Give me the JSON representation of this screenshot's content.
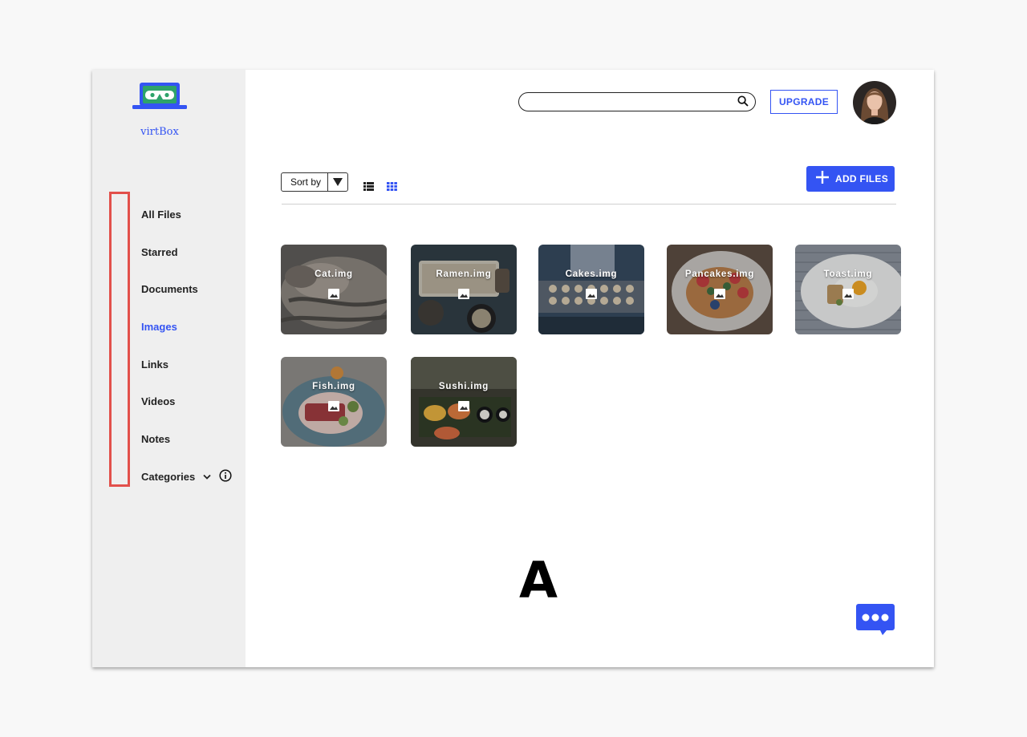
{
  "app": {
    "logo_text": "virtBox",
    "brand_color": "#3454f3",
    "logo_color": "#2ea36a"
  },
  "header": {
    "search": {
      "value": "",
      "placeholder": "",
      "icon": "search-icon"
    },
    "upgrade_label": "UPGRADE",
    "avatar": "user-avatar"
  },
  "sidebar": {
    "highlight_color": "#e2504b",
    "items": [
      {
        "label": "All Files",
        "active": false
      },
      {
        "label": "Starred",
        "active": false
      },
      {
        "label": "Documents",
        "active": false
      },
      {
        "label": "Images",
        "active": true
      },
      {
        "label": "Links",
        "active": false
      },
      {
        "label": "Videos",
        "active": false
      },
      {
        "label": "Notes",
        "active": false
      },
      {
        "label": "Categories",
        "active": false,
        "icons": [
          "chevron-down-icon",
          "info-icon"
        ]
      }
    ]
  },
  "toolbar": {
    "sort_label": "Sort by",
    "view_modes": [
      "list-view-icon",
      "grid-view-icon"
    ],
    "active_view": "grid",
    "add_files_label": "ADD FILES"
  },
  "files": [
    {
      "name": "Cat.img",
      "icon": "image-icon"
    },
    {
      "name": "Ramen.img",
      "icon": "image-icon"
    },
    {
      "name": "Cakes.img",
      "icon": "image-icon"
    },
    {
      "name": "Pancakes.img",
      "icon": "image-icon"
    },
    {
      "name": "Toast.img",
      "icon": "image-icon"
    },
    {
      "name": "Fish.img",
      "icon": "image-icon"
    },
    {
      "name": "Sushi.img",
      "icon": "image-icon"
    }
  ],
  "annotation_letter": "A",
  "chat": {
    "icon": "chat-bubble-icon"
  }
}
